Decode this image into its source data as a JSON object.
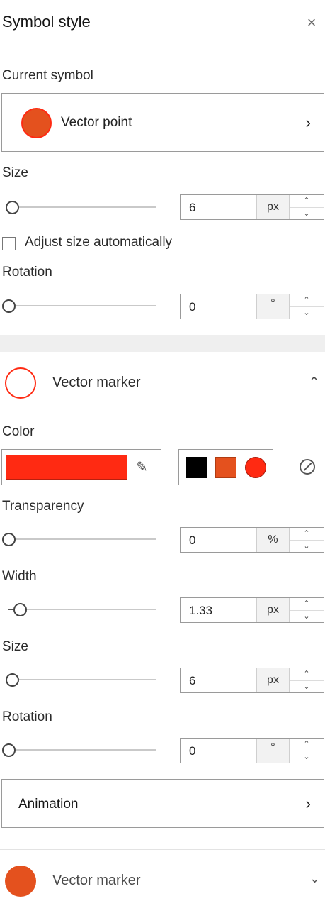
{
  "header": {
    "title": "Symbol style",
    "close_icon": "close-icon"
  },
  "current_symbol": {
    "label": "Current symbol",
    "name": "Vector point",
    "color": "#e4511e",
    "border": "#ff2a12"
  },
  "size": {
    "label": "Size",
    "value": "6",
    "unit": "px"
  },
  "adjust": {
    "label": "Adjust size automatically",
    "checked": false
  },
  "rotation": {
    "label": "Rotation",
    "value": "0",
    "unit": "°"
  },
  "marker1": {
    "title": "Vector marker",
    "ring_color": "#ff2a12",
    "expand_icon": "chevron-up-icon"
  },
  "color": {
    "label": "Color",
    "current": "#ff2a12",
    "edit_icon": "pencil-icon",
    "presets": [
      "#000000",
      "#e4511e",
      "#ff2a12"
    ],
    "none_icon": "no-color-icon"
  },
  "transparency": {
    "label": "Transparency",
    "value": "0",
    "unit": "%"
  },
  "width": {
    "label": "Width",
    "value": "1.33",
    "unit": "px"
  },
  "size2": {
    "label": "Size",
    "value": "6",
    "unit": "px"
  },
  "rotation2": {
    "label": "Rotation",
    "value": "0",
    "unit": "°"
  },
  "animation": {
    "label": "Animation"
  },
  "marker2": {
    "title": "Vector marker",
    "dot_color": "#e4511e",
    "expand_icon": "chevron-down-icon"
  },
  "spinner": {
    "up": "⌃",
    "down": "⌄"
  },
  "chev_right": "›"
}
